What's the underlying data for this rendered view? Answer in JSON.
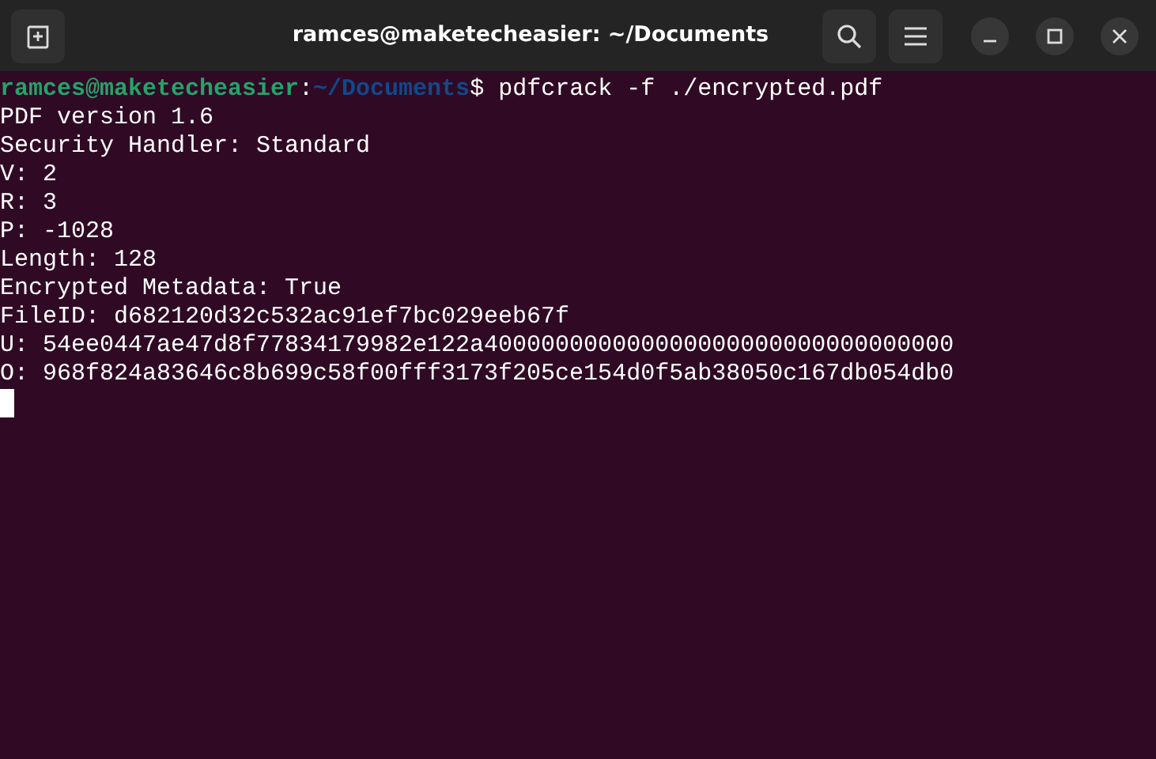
{
  "window": {
    "title": "ramces@maketecheasier: ~/Documents"
  },
  "prompt": {
    "user_host": "ramces@maketecheasier",
    "separator": ":",
    "path": "~/Documents",
    "symbol": "$",
    "command": "pdfcrack -f ./encrypted.pdf"
  },
  "output": [
    "PDF version 1.6",
    "Security Handler: Standard",
    "V: 2",
    "R: 3",
    "P: -1028",
    "Length: 128",
    "Encrypted Metadata: True",
    "FileID: d682120d32c532ac91ef7bc029eeb67f",
    "U: 54ee0447ae47d8f77834179982e122a400000000000000000000000000000000",
    "O: 968f824a83646c8b699c58f00fff3173f205ce154d0f5ab38050c167db054db0"
  ]
}
